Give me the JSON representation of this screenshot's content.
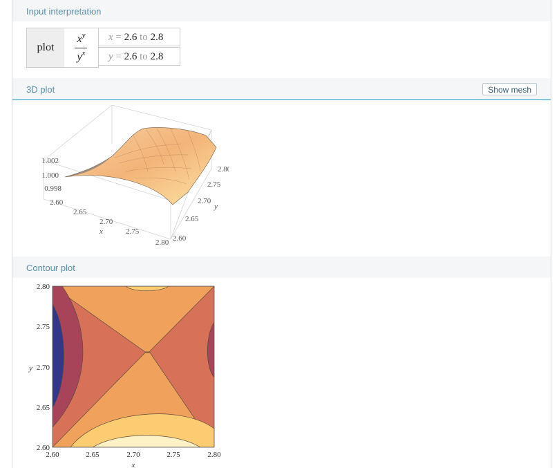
{
  "pods": {
    "input": {
      "title": "Input interpretation",
      "plot_label": "plot",
      "frac_num_base": "x",
      "frac_num_exp": "y",
      "frac_den_base": "y",
      "frac_den_exp": "x",
      "x_var": "x",
      "x_from": "2.6",
      "x_to": "2.8",
      "y_var": "y",
      "y_from": "2.6",
      "y_to": "2.8",
      "eq": "=",
      "to_word": "to"
    },
    "plot3d": {
      "title": "3D plot",
      "show_mesh_label": "Show mesh",
      "z_ticks": [
        "1.002",
        "1.000",
        "0.998"
      ],
      "x_ticks": [
        "2.60",
        "2.65",
        "2.70",
        "2.75",
        "2.80"
      ],
      "y_ticks": [
        "2.60",
        "2.65",
        "2.70",
        "2.75",
        "2.80"
      ],
      "x_label": "x",
      "y_label": "y"
    },
    "contour": {
      "title": "Contour plot",
      "x_ticks": [
        "2.60",
        "2.65",
        "2.70",
        "2.75",
        "2.80"
      ],
      "y_ticks": [
        "2.80",
        "2.75",
        "2.70",
        "2.65",
        "2.60"
      ],
      "x_label": "x",
      "y_label": "y"
    }
  },
  "colors": {
    "header_bg": "#f4f6f7",
    "title_color": "#5b8fa8",
    "active_underline": "#86c5e4"
  }
}
